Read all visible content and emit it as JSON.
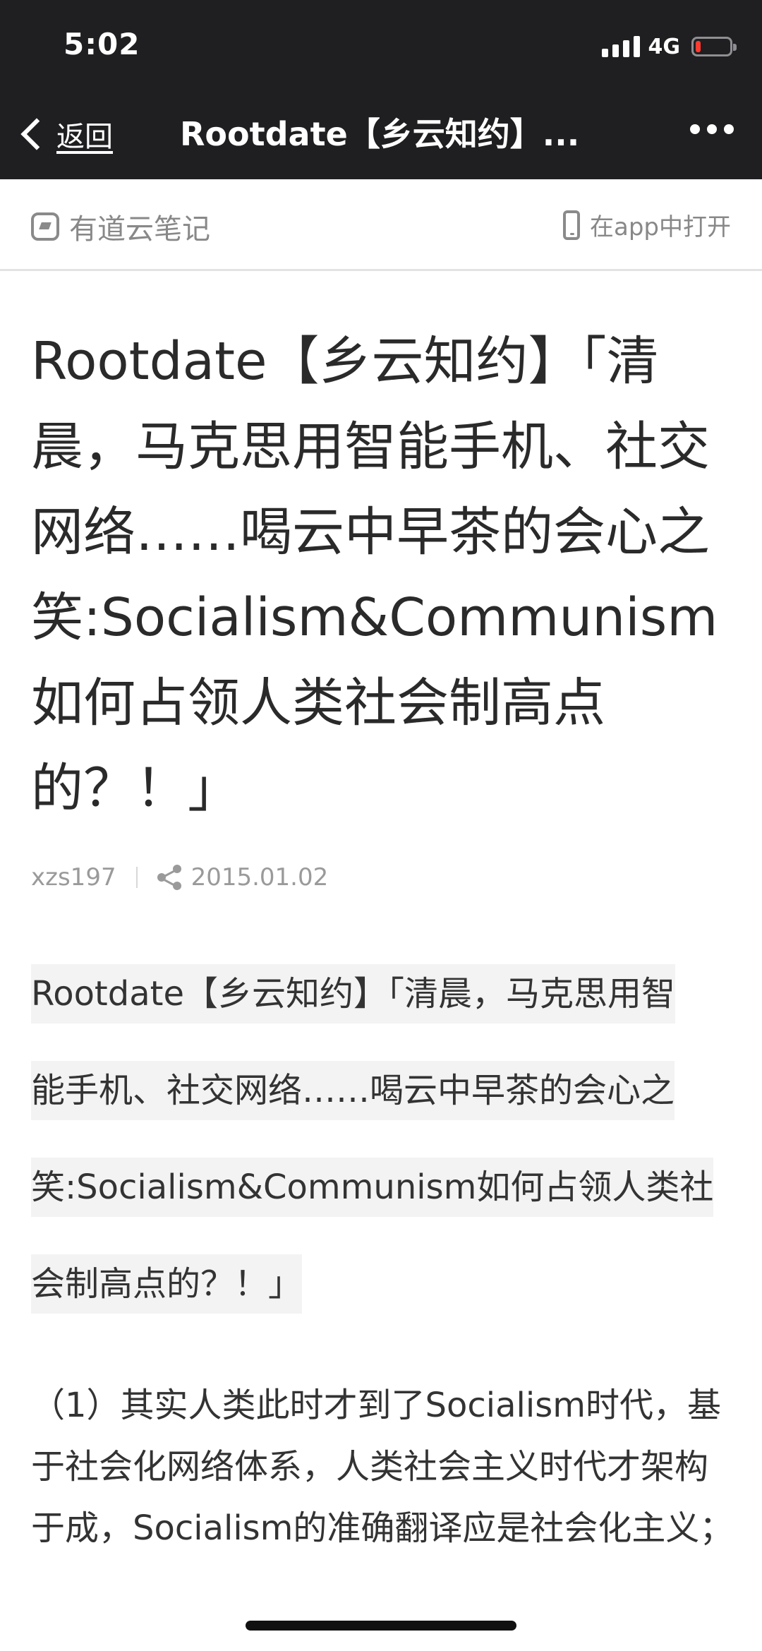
{
  "status_bar": {
    "time": "5:02",
    "network": "4G",
    "battery_level": 0.15,
    "signal_bars": 4
  },
  "nav": {
    "back_label": "返回",
    "title": "Rootdate【乡云知约】...",
    "more_icon": "more-icon"
  },
  "brand_bar": {
    "brand_name": "有道云笔记",
    "open_in_app": "在app中打开"
  },
  "article": {
    "title": "Rootdate【乡云知约】「清晨，马克思用智能手机、社交网络……喝云中早茶的会心之笑:Socialism&Communism如何占领人类社会制高点的？！」",
    "author": "xzs197",
    "date": "2015.01.02",
    "quote_lines": [
      "Rootdate【乡云知约】「清晨，马克思用智",
      "能手机、社交网络……喝云中早茶的会心之",
      "笑:Socialism&Communism如何占领人类社",
      "会制高点的？！」"
    ],
    "paragraph": "（1）其实人类此时才到了Socialism时代，基于社会化网络体系，人类社会主义时代才架构于成，Socialism的准确翻译应是社会化主义；"
  },
  "colors": {
    "nav_background": "#1f1f21",
    "battery_low": "#ff3b30",
    "highlight_background": "#f3f3f3"
  }
}
